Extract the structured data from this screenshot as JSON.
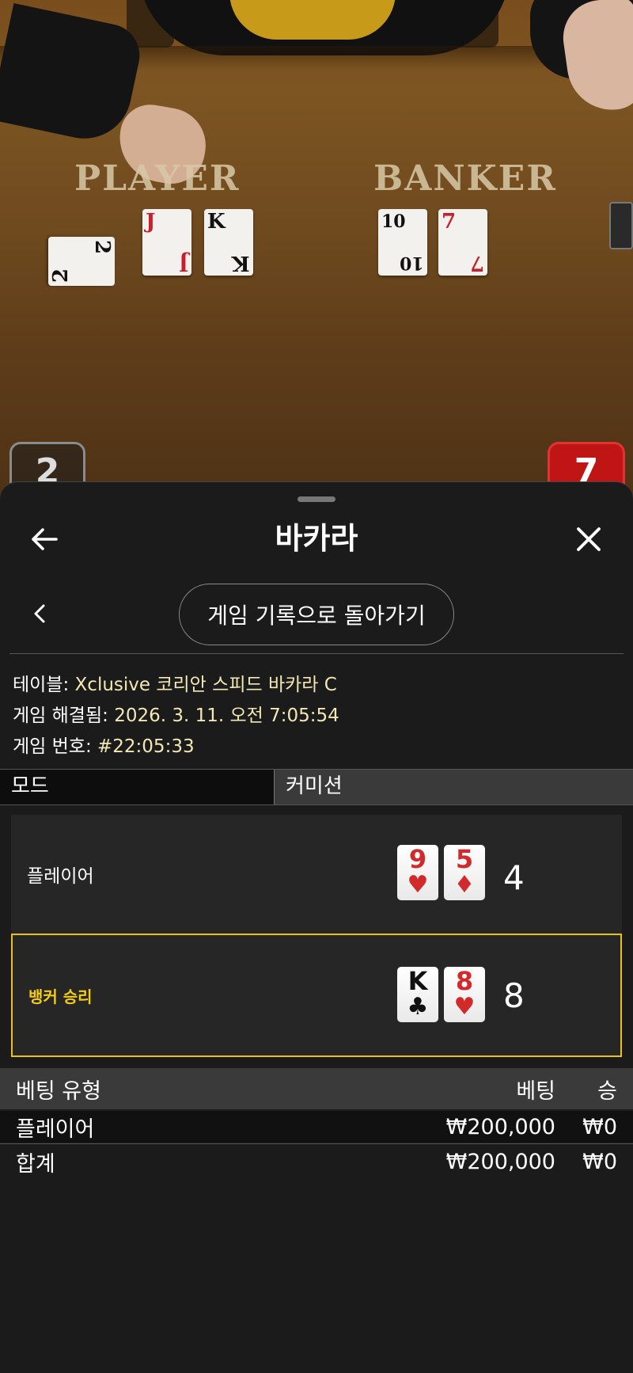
{
  "scene": {
    "player_label": "PLAYER",
    "banker_label": "BANKER",
    "player_cards": [
      {
        "rank": "2",
        "suit": "♠",
        "color": "black"
      },
      {
        "rank": "J",
        "suit": "♥",
        "color": "red"
      },
      {
        "rank": "K",
        "suit": "♠",
        "color": "black"
      }
    ],
    "banker_cards": [
      {
        "rank": "10",
        "suit": "♠",
        "color": "black"
      },
      {
        "rank": "7",
        "suit": "♥",
        "color": "red"
      }
    ],
    "corner_left": "2",
    "corner_right": "7"
  },
  "sheet": {
    "title": "바카라",
    "back_icon": "arrow-left-icon",
    "close_icon": "close-icon",
    "history_button": "게임 기록으로 돌아가기"
  },
  "info": {
    "table_label": "테이블:",
    "table_value": "Xclusive 코리안 스피드 바카라 C",
    "resolved_label": "게임 해결됨:",
    "resolved_value": "2026. 3. 11. 오전 7:05:54",
    "number_label": "게임 번호:",
    "number_value": "#22:05:33"
  },
  "mode": {
    "label": "모드",
    "value": "커미션"
  },
  "results": {
    "player": {
      "label": "플레이어",
      "cards": [
        {
          "rank": "9",
          "suit": "♥",
          "color": "red"
        },
        {
          "rank": "5",
          "suit": "♦",
          "color": "red"
        }
      ],
      "score": "4"
    },
    "banker": {
      "label": "뱅커 승리",
      "cards": [
        {
          "rank": "K",
          "suit": "♣",
          "color": "black"
        },
        {
          "rank": "8",
          "suit": "♥",
          "color": "red"
        }
      ],
      "score": "8"
    }
  },
  "bets": {
    "headers": {
      "type": "베팅 유형",
      "bet": "베팅",
      "win": "승"
    },
    "rows": [
      {
        "type": "플레이어",
        "bet": "₩200,000",
        "win": "₩0"
      }
    ],
    "total": {
      "type": "합계",
      "bet": "₩200,000",
      "win": "₩0"
    }
  },
  "colors": {
    "accent_gold": "#e9c219",
    "background": "#1b1b1b",
    "card_red": "#d22a2a"
  }
}
